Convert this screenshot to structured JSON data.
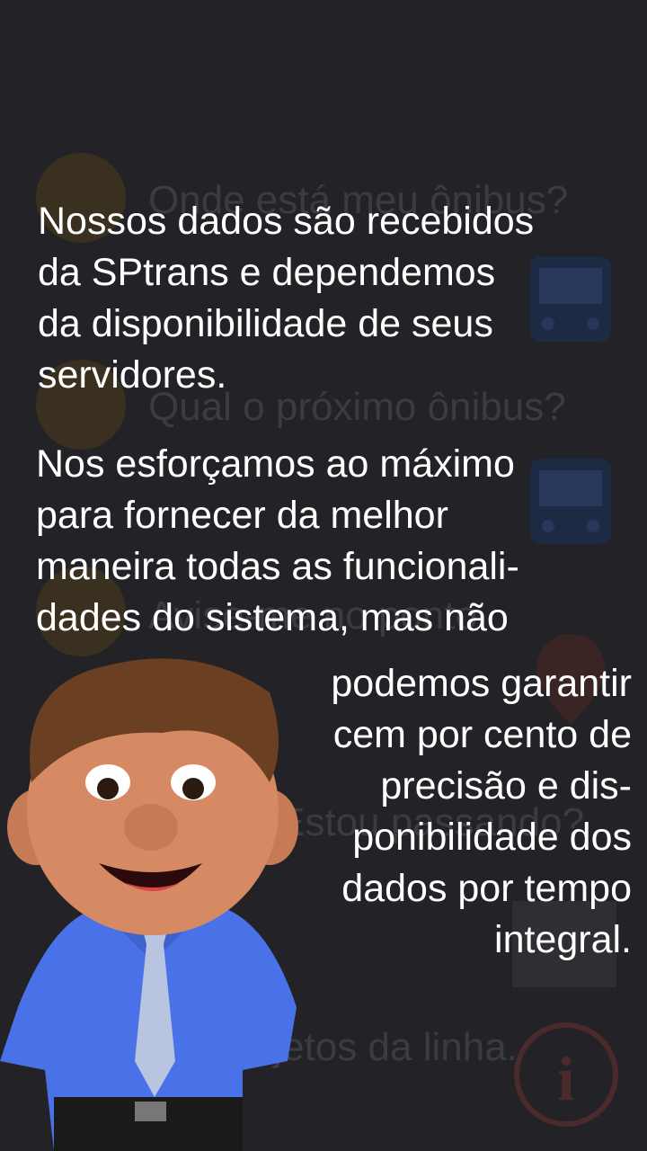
{
  "background_menu": {
    "items": [
      {
        "label": "Onde está meu ônibus?"
      },
      {
        "label": "Qual o próximo ônibus?"
      },
      {
        "label": "Avise-me no ponto"
      },
      {
        "label": "Estou passando?"
      },
      {
        "label": "Trajetos da linha."
      }
    ],
    "info_icon": "info-icon",
    "bus_icon": "bus-icon",
    "map_icon": "map-icon",
    "pin_icon": "location-pin-icon"
  },
  "message": {
    "paragraph_1": "Nossos dados são recebidos\nda SPtrans e dependemos\nda disponibilidade de seus\nservidores.",
    "paragraph_2": "Nos esforçamos ao máximo\npara fornecer da melhor\nmaneira todas as funcionali-\ndades do sistema, mas não",
    "paragraph_3": "podemos garantir\ncem por cento de\nprecisão e dis-\nponibilidade dos\ndados por tempo\nintegral."
  },
  "colors": {
    "background": "#232327",
    "text": "#ffffff",
    "shirt": "#4a72e8",
    "tie": "#b8c4e0",
    "hair": "#6b3f22",
    "skin": "#d58a63"
  }
}
